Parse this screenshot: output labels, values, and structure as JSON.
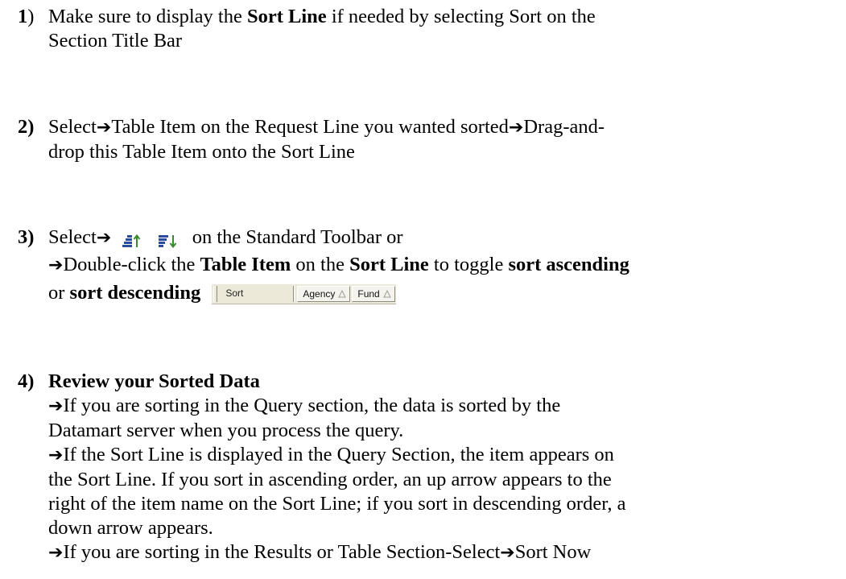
{
  "steps": [
    {
      "number": "1",
      "paren": ")",
      "text_a": "Make sure to display the ",
      "bold_a": "Sort Line",
      "text_b": " if needed by selecting Sort on the",
      "text_c": "Section Title Bar"
    },
    {
      "number": "2)",
      "text_a": "Select",
      "text_b": "Table Item on the Request Line you wanted sorted",
      "text_c": "Drag-and-",
      "text_d": "drop this Table Item onto the Sort Line"
    },
    {
      "number": "3)",
      "text_a": "Select",
      "text_b": " on the Standard Toolbar or",
      "text_c": "Double-click the ",
      "bold_table_item": "Table Item",
      "text_d": " on the ",
      "bold_sort_line": "Sort Line",
      "text_e": " to toggle ",
      "bold_sort_asc": "sort ascending",
      "text_f": "or ",
      "bold_sort_desc": "sort descending"
    },
    {
      "number": "4)",
      "heading": "Review your Sorted Data",
      "para1_a": "If you are sorting in the Query section, the data is sorted by the",
      "para1_b": "Datamart server when you process the query.",
      "para2_a": "If the Sort Line is displayed in the Query Section, the item appears on",
      "para2_b": "the Sort Line. If you sort in ascending order, an up arrow appears to the",
      "para2_c": "right of the item name on the Sort Line; if you sort in descending order, a",
      "para2_d": "down arrow appears.",
      "para3_a": "If you are sorting in the Results or Table Section-Select",
      "para3_b": "Sort Now"
    }
  ],
  "arrow_glyph": "➔",
  "toolbar_icons": [
    "sort-ascending-icon",
    "sort-descending-icon"
  ],
  "sort_bar": {
    "label": "Sort",
    "items": [
      {
        "label": "Agency",
        "direction": "ascending"
      },
      {
        "label": "Fund",
        "direction": "ascending"
      }
    ]
  },
  "colors": {
    "text": "#000000",
    "toolbar_bg": "#ece9d8",
    "icon_blue": "#2b4c9a",
    "icon_green": "#3a8a2e"
  }
}
